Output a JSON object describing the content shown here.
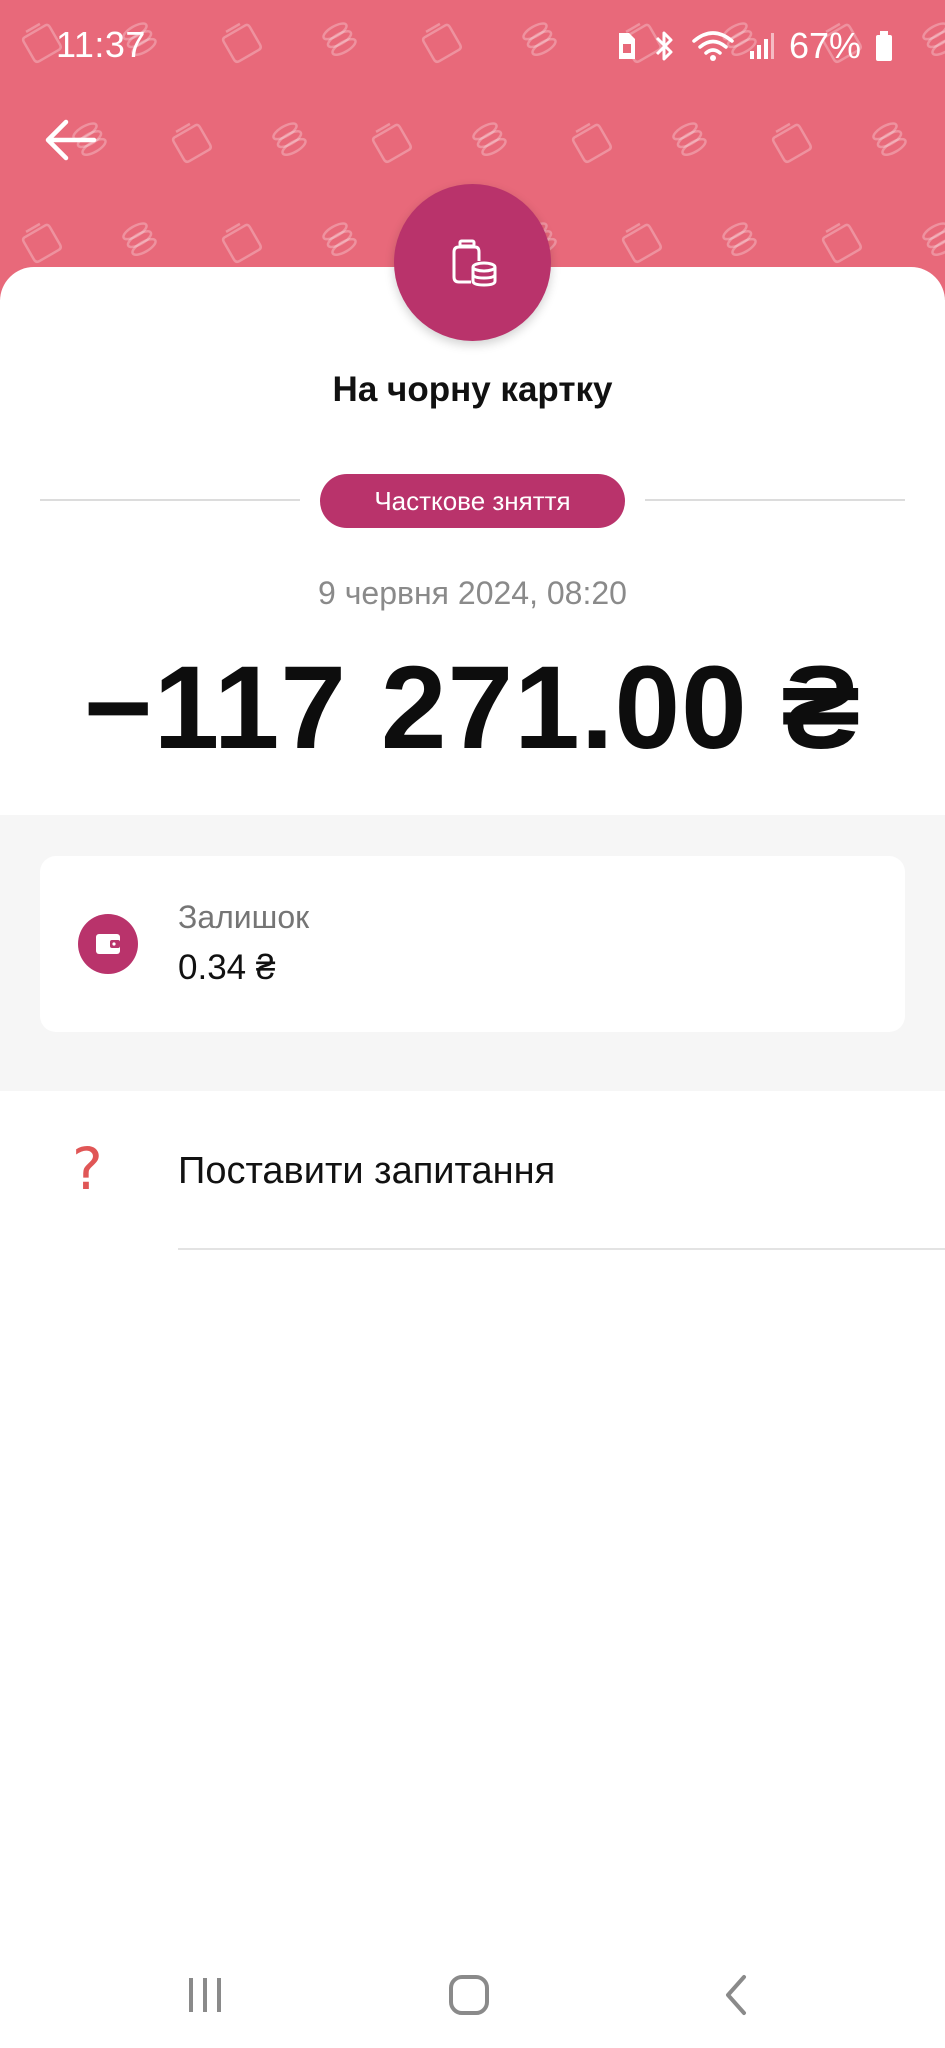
{
  "status_bar": {
    "time": "11:37",
    "battery": "67%",
    "icons": [
      "sim-icon",
      "bluetooth-icon",
      "wifi-icon",
      "signal-icon",
      "battery-icon"
    ]
  },
  "header": {
    "back_icon": "back-arrow-icon",
    "background_color": "#e8697a",
    "jar_icon": "jar-coins-icon"
  },
  "transaction": {
    "title": "На чорну картку",
    "type": "Часткове зняття",
    "date": "9 червня 2024, 08:20",
    "amount": "−117 271.00 ₴",
    "accent_color": "#b9336b"
  },
  "balance": {
    "icon": "wallet-icon",
    "label": "Залишок",
    "value": "0.34 ₴"
  },
  "actions": {
    "ask_question": {
      "icon": "question-icon",
      "glyph": "?",
      "label": "Поставити запитання"
    }
  },
  "nav_bar": {
    "items": [
      "recent-apps-icon",
      "home-icon",
      "back-icon"
    ]
  }
}
